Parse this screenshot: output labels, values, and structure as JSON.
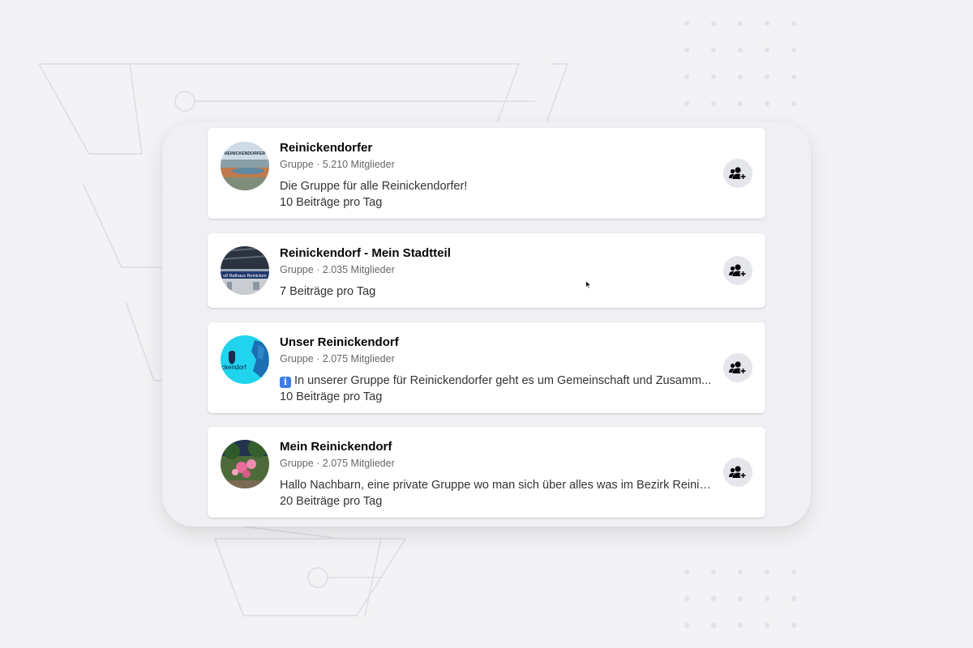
{
  "groups": [
    {
      "title": "Reinickendorfer",
      "meta": "Gruppe · 5.210 Mitglieder",
      "description": "Die Gruppe für alle Reinickendorfer!",
      "rate": "10 Beiträge pro Tag",
      "avatar_text": "REINICKENDORFER"
    },
    {
      "title": "Reinickendorf - Mein Stadtteil",
      "meta": "Gruppe · 2.035 Mitglieder",
      "description": "",
      "rate": "7 Beiträge pro Tag",
      "avatar_text": "ulf Rathaus Reinicken"
    },
    {
      "title": "Unser Reinickendorf",
      "meta": "Gruppe · 2.075 Mitglieder",
      "description": "In unserer Gruppe für Reinickendorfer geht es um Gemeinschaft und Zusamm...",
      "rate": "10 Beiträge pro Tag",
      "avatar_text": "ckendorf"
    },
    {
      "title": "Mein Reinickendorf",
      "meta": "Gruppe · 2.075 Mitglieder",
      "description": "Hallo Nachbarn, eine private Gruppe wo man sich über alles was im Bezirk Reinic...",
      "rate": "20 Beiträge pro Tag",
      "avatar_text": ""
    }
  ],
  "icons": {
    "join": "join-group-icon",
    "info": "information-emoji-icon"
  },
  "colors": {
    "background": "#f3f2f4",
    "panel": "#efeff4",
    "card": "#ffffff",
    "button": "#e4e6eb",
    "title_text": "#050505",
    "meta_text": "#65676b",
    "cyan_avatar": "#20d4ee"
  }
}
